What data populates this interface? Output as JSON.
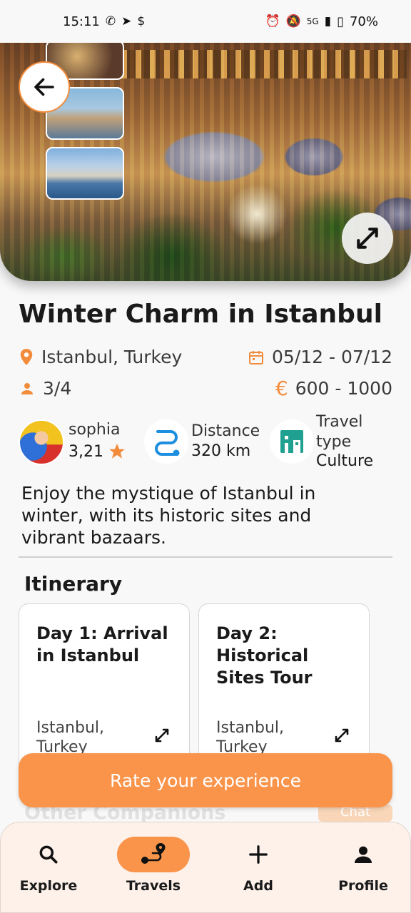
{
  "status_bar": {
    "time": "15:11",
    "battery": "70%",
    "network": "5G"
  },
  "trip": {
    "title": "Winter Charm in Istanbul",
    "location": "Istanbul, Turkey",
    "dates": "05/12 - 07/12",
    "participants": "3/4",
    "budget": "600 - 1000",
    "description": "Enjoy the mystique of Istanbul in winter, with its historic sites and vibrant bazaars."
  },
  "host": {
    "name": "sophia",
    "rating": "3,21"
  },
  "distance": {
    "label": "Distance",
    "value": "320 km"
  },
  "travel_type": {
    "label": "Travel type",
    "value": "Culture"
  },
  "itinerary": {
    "title": "Itinerary",
    "days": [
      {
        "title": "Day 1: Arrival in Istanbul",
        "location": "Istanbul, Turkey"
      },
      {
        "title": "Day 2: Historical Sites Tour",
        "location": "Istanbul, Turkey"
      }
    ]
  },
  "companions": {
    "title": "Other Companions",
    "chat_label": "Chat"
  },
  "rate_button": "Rate your experience",
  "nav": {
    "items": [
      {
        "label": "Explore",
        "icon": "search-icon"
      },
      {
        "label": "Travels",
        "icon": "route-icon"
      },
      {
        "label": "Add",
        "icon": "plus-icon"
      },
      {
        "label": "Profile",
        "icon": "person-icon"
      }
    ],
    "active": "Travels"
  },
  "colors": {
    "accent": "#f9944a",
    "accent_dark": "#f28c3c",
    "nav_bg": "#fdf1ea",
    "distance_blue": "#1e8fe0",
    "culture_teal": "#20a090"
  }
}
